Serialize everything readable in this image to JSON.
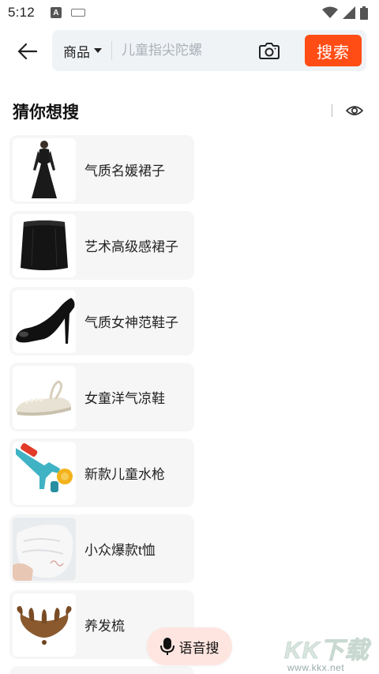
{
  "status_bar": {
    "time": "5:12",
    "notification_letter": "A"
  },
  "search": {
    "category_label": "商品",
    "placeholder": "儿童指尖陀螺",
    "button_label": "搜索",
    "accent_color": "#ff4d15"
  },
  "suggestions": {
    "title": "猜你想搜",
    "items": [
      {
        "label": "气质名媛裙子",
        "icon": "black-dress-image"
      },
      {
        "label": "艺术高级感裙子",
        "icon": "black-skirt-image"
      },
      {
        "label": "气质女神范鞋子",
        "icon": "black-heel-image"
      },
      {
        "label": "女童洋气凉鞋",
        "icon": "sandal-image"
      },
      {
        "label": "新款儿童水枪",
        "icon": "water-gun-image"
      },
      {
        "label": "小众爆款t恤",
        "icon": "white-tshirt-image"
      },
      {
        "label": "养发梳",
        "icon": "wooden-comb-image"
      }
    ]
  },
  "voice": {
    "label": "语音搜"
  },
  "watermark": {
    "brand": "KK下载",
    "url": "www.kkx.net"
  }
}
